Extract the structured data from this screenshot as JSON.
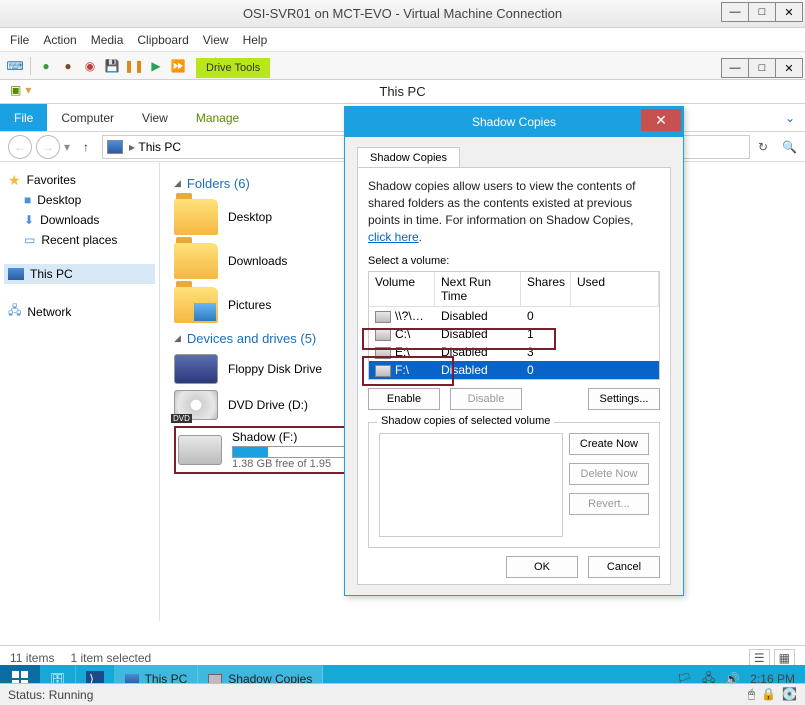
{
  "vm": {
    "title": "OSI-SVR01 on MCT-EVO - Virtual Machine Connection",
    "menu": [
      "File",
      "Action",
      "Media",
      "Clipboard",
      "View",
      "Help"
    ],
    "status": "Status: Running"
  },
  "explorer": {
    "window_title": "This PC",
    "drive_tools_tab": "Drive Tools",
    "tabs": {
      "file": "File",
      "computer": "Computer",
      "view": "View",
      "manage": "Manage"
    },
    "breadcrumb": "This PC",
    "tree": {
      "favorites": "Favorites",
      "desktop": "Desktop",
      "downloads": "Downloads",
      "recent": "Recent places",
      "thispc": "This PC",
      "network": "Network"
    },
    "group_folders": "Folders (6)",
    "folders": [
      "Desktop",
      "Downloads",
      "Pictures"
    ],
    "group_drives": "Devices and drives (5)",
    "drives": {
      "floppy": "Floppy Disk Drive",
      "dvd": "DVD Drive (D:)",
      "shadow_name": "Shadow (F:)",
      "shadow_free": "1.38 GB free of 1.95"
    },
    "status": {
      "items": "11 items",
      "selected": "1 item selected"
    }
  },
  "dialog": {
    "title": "Shadow Copies",
    "tab": "Shadow Copies",
    "desc1": "Shadow copies allow users to view the contents of shared folders as the contents existed at previous points in time. For information on Shadow Copies, ",
    "desc_link": "click here",
    "select_volume": "Select a volume:",
    "columns": {
      "volume": "Volume",
      "next": "Next Run Time",
      "shares": "Shares",
      "used": "Used"
    },
    "rows": [
      {
        "vol": "\\\\?\\Vol...",
        "next": "Disabled",
        "shares": "0",
        "used": ""
      },
      {
        "vol": "C:\\",
        "next": "Disabled",
        "shares": "1",
        "used": ""
      },
      {
        "vol": "E:\\",
        "next": "Disabled",
        "shares": "3",
        "used": ""
      },
      {
        "vol": "F:\\",
        "next": "Disabled",
        "shares": "0",
        "used": ""
      }
    ],
    "btn_enable": "Enable",
    "btn_disable": "Disable",
    "btn_settings": "Settings...",
    "group_label": "Shadow copies of selected volume",
    "btn_create": "Create Now",
    "btn_delete": "Delete Now",
    "btn_revert": "Revert...",
    "btn_ok": "OK",
    "btn_cancel": "Cancel"
  },
  "taskbar": {
    "thispc": "This PC",
    "shadow": "Shadow Copies",
    "time": "2:16 PM"
  }
}
